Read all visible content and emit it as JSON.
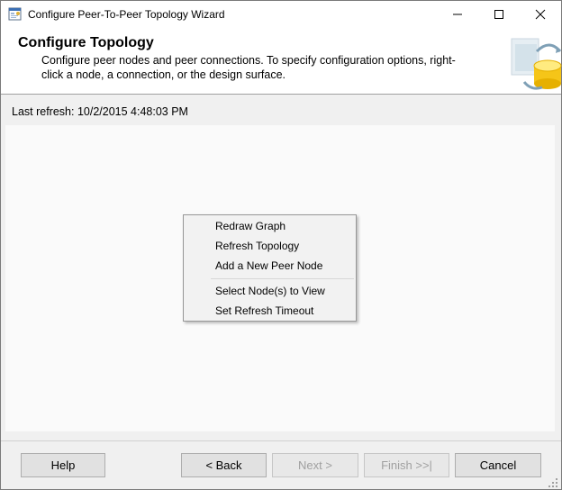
{
  "window": {
    "title": "Configure Peer-To-Peer Topology Wizard"
  },
  "header": {
    "title": "Configure Topology",
    "description": "Configure peer nodes and peer connections. To specify configuration options, right-click a node, a connection, or the design surface."
  },
  "refresh": {
    "label": "Last refresh: 10/2/2015 4:48:03 PM"
  },
  "context_menu": {
    "items": [
      {
        "label": "Redraw Graph",
        "mnemonic": "G"
      },
      {
        "label": "Refresh Topology",
        "mnemonic": "R"
      },
      {
        "label": "Add a New Peer Node",
        "mnemonic": "A"
      },
      {
        "label": "Select Node(s) to View",
        "mnemonic": "S"
      },
      {
        "label": "Set Refresh Timeout",
        "mnemonic": "T"
      }
    ]
  },
  "buttons": {
    "help": "Help",
    "back": "< Back",
    "next": "Next >",
    "finish": "Finish >>|",
    "cancel": "Cancel"
  },
  "icons": {
    "title": "wizard-window-icon",
    "header": "database-topology-graphic",
    "minimize": "minimize-icon",
    "maximize": "maximize-icon",
    "close": "close-icon",
    "grip": "resize-grip-icon"
  },
  "colors": {
    "surface": "#fafafa",
    "window_bg": "#f0f0f0",
    "disabled_text": "#a0a0a0"
  }
}
